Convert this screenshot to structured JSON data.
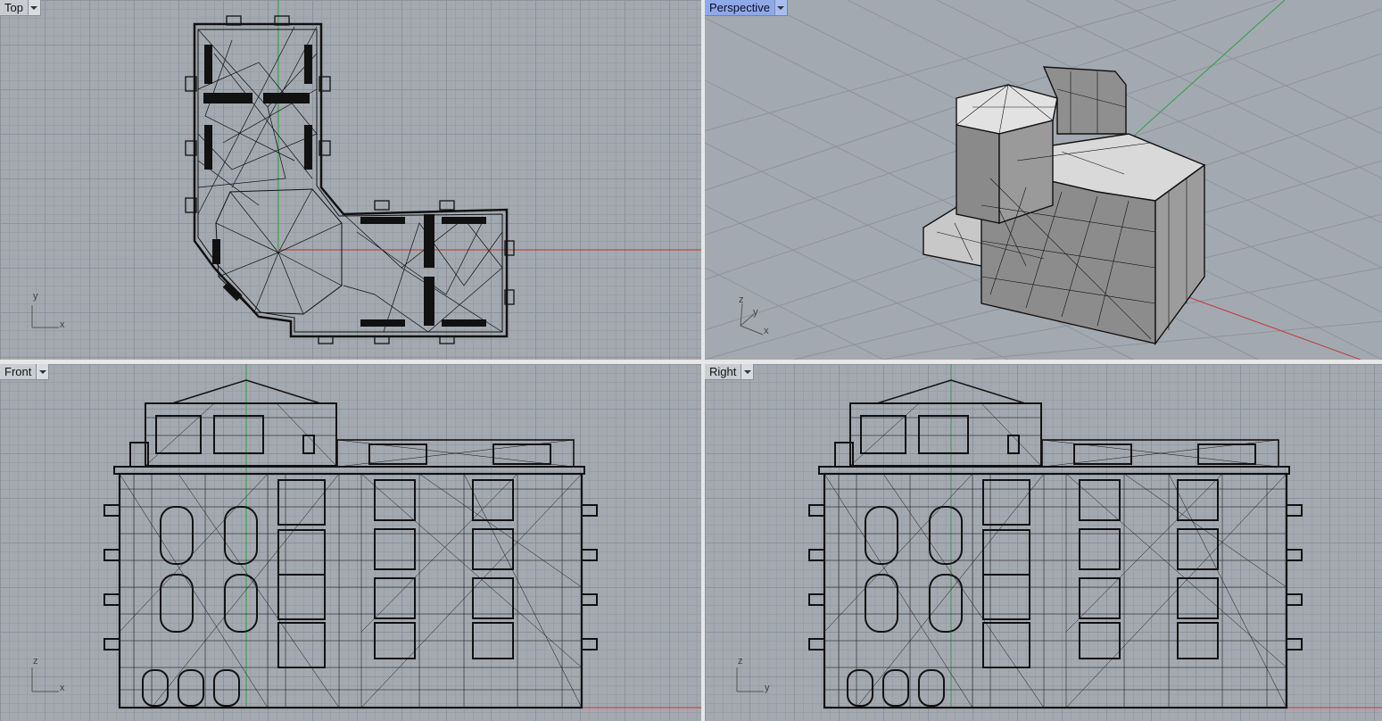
{
  "viewports": {
    "top": {
      "label": "Top",
      "axis_u": "x",
      "axis_v": "y"
    },
    "perspective": {
      "label": "Perspective",
      "axis_u": "x",
      "axis_v": "y",
      "axis_w": "z"
    },
    "front": {
      "label": "Front",
      "axis_u": "x",
      "axis_v": "z"
    },
    "right": {
      "label": "Right",
      "axis_u": "y",
      "axis_v": "z"
    }
  },
  "colors": {
    "viewport_bg": "#a3a9b0",
    "active_label": "#8ea8e8",
    "x_axis": "#c0393b",
    "y_axis": "#2ea043",
    "wire": "#111111"
  },
  "icons": [
    "viewport-menu-icon",
    "axis-gizmo-icon"
  ]
}
